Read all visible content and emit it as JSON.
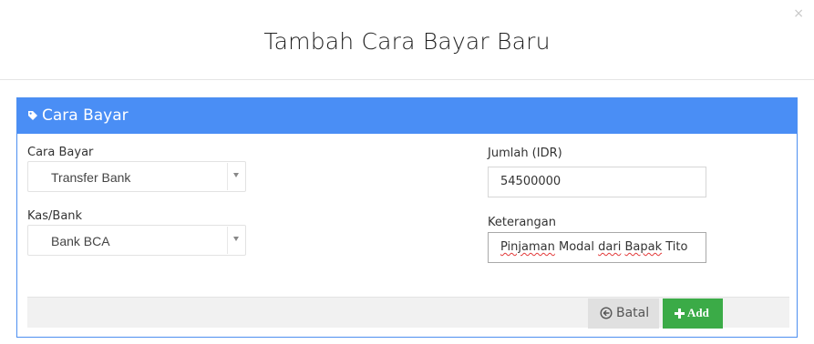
{
  "modal": {
    "title": "Tambah Cara Bayar Baru",
    "close_symbol": "×"
  },
  "panel": {
    "heading": "Cara Bayar",
    "heading_icon": "tag-icon",
    "accent_color": "#4a8ef5"
  },
  "form": {
    "cara_bayar": {
      "label": "Cara Bayar",
      "value": "Transfer Bank"
    },
    "kas_bank": {
      "label": "Kas/Bank",
      "value": "Bank BCA"
    },
    "jumlah": {
      "label": "Jumlah (IDR)",
      "value": "54500000"
    },
    "keterangan": {
      "label": "Keterangan",
      "words": [
        "Pinjaman",
        "Modal",
        "dari",
        "Bapak",
        "Tito"
      ]
    }
  },
  "footer": {
    "batal_label": "Batal",
    "batal_icon": "arrow-circle-left-icon",
    "add_label": "Add",
    "add_icon": "plus-icon",
    "add_color": "#3bab47"
  }
}
